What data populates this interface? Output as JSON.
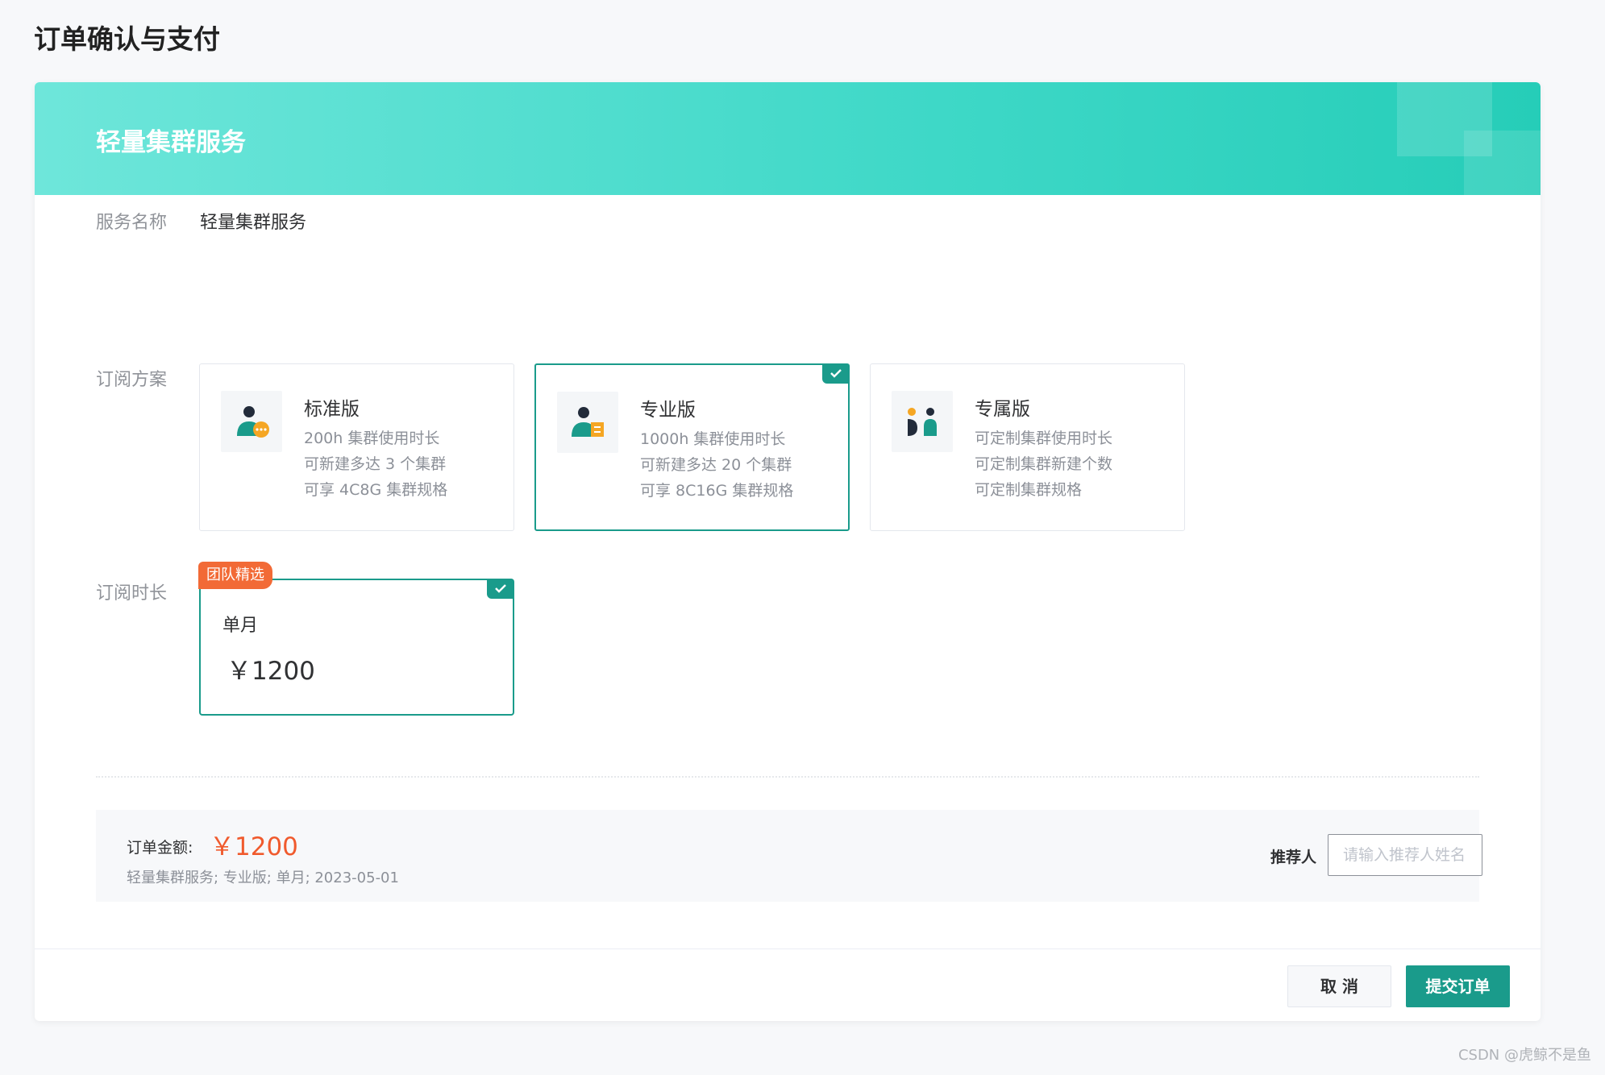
{
  "page": {
    "title": "订单确认与支付"
  },
  "banner": {
    "title": "轻量集群服务"
  },
  "form": {
    "service_label": "服务名称",
    "service_value": "轻量集群服务",
    "plan_label": "订阅方案",
    "duration_label": "订阅时长"
  },
  "plans": [
    {
      "name": "标准版",
      "features": [
        "200h 集群使用时长",
        "可新建多达 3 个集群",
        "可享 4C8G 集群规格"
      ],
      "selected": false,
      "icon": "user-chat-icon"
    },
    {
      "name": "专业版",
      "features": [
        "1000h 集群使用时长",
        "可新建多达 20 个集群",
        "可享 8C16G 集群规格"
      ],
      "selected": true,
      "icon": "user-document-icon"
    },
    {
      "name": "专属版",
      "features": [
        "可定制集群使用时长",
        "可定制集群新建个数",
        "可定制集群规格"
      ],
      "selected": false,
      "icon": "two-users-icon"
    }
  ],
  "duration": {
    "badge": "团队精选",
    "name": "单月",
    "price": "￥1200",
    "selected": true
  },
  "summary": {
    "amount_label": "订单金额:",
    "amount": "￥1200",
    "description": "轻量集群服务; 专业版; 单月; 2023-05-01",
    "referrer_label": "推荐人",
    "referrer_placeholder": "请输入推荐人姓名",
    "referrer_value": ""
  },
  "actions": {
    "cancel_label": "取 消",
    "submit_label": "提交订单"
  },
  "watermark": "CSDN @虎鲸不是鱼",
  "colors": {
    "accent": "#1a9b8b",
    "banner_start": "#6ee6da",
    "banner_end": "#26cdb8",
    "price": "#f05a2d",
    "badge": "#f26a36",
    "icon_dark": "#222b3a",
    "icon_orange": "#f5a623"
  }
}
